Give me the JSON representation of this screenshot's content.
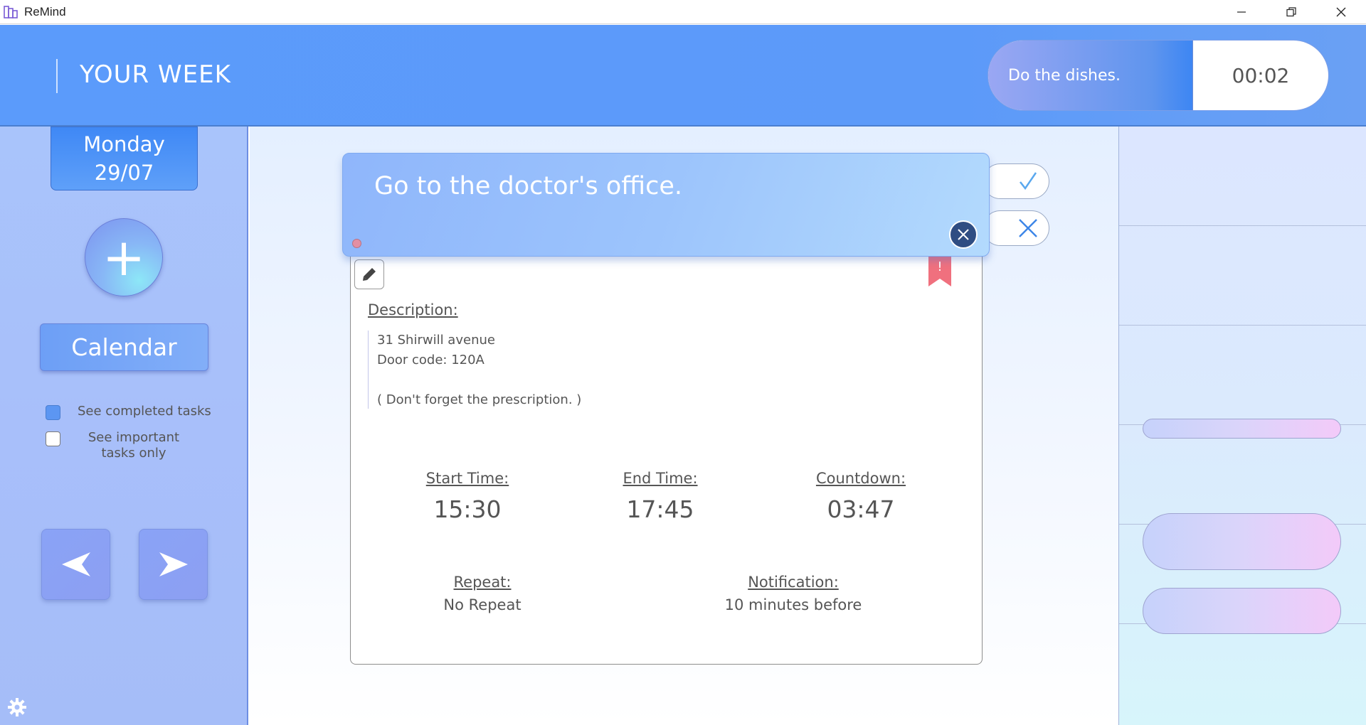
{
  "window": {
    "title": "ReMind"
  },
  "header": {
    "title": "YOUR WEEK",
    "current_task": {
      "name": "Do the dishes.",
      "time": "00:02"
    }
  },
  "sidebar": {
    "day": "Monday",
    "date": "29/07",
    "add_label": "+",
    "calendar_label": "Calendar",
    "filters": [
      {
        "label": "See completed tasks",
        "checked": true
      },
      {
        "label": "See important tasks only",
        "checked": false
      }
    ],
    "prev_label": "◀",
    "next_label": "▶"
  },
  "task": {
    "title": "Go to the doctor's office.",
    "description_label": "Description:",
    "description_lines": [
      "31 Shirwill avenue",
      "Door code: 120A",
      "",
      "( Don't forget the prescription. )"
    ],
    "start_label": "Start Time:",
    "start_value": "15:30",
    "end_label": "End Time:",
    "end_value": "17:45",
    "countdown_label": "Countdown:",
    "countdown_value": "03:47",
    "repeat_label": "Repeat:",
    "repeat_value": "No Repeat",
    "notification_label": "Notification:",
    "notification_value": "10 minutes before",
    "important_mark": "!"
  },
  "colors": {
    "accent": "#5b9bfb",
    "important": "#f0707e",
    "dark_close": "#2f4d82"
  }
}
